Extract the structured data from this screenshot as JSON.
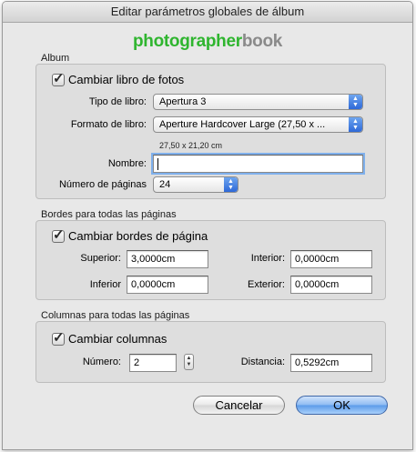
{
  "window": {
    "title": "Editar parámetros globales de álbum"
  },
  "logo": {
    "part1": "photographer",
    "part2": "book"
  },
  "album": {
    "section_label": "Album",
    "change_book": {
      "label": "Cambiar libro de fotos",
      "checked": true
    },
    "book_type": {
      "label": "Tipo de libro:",
      "value": "Apertura 3"
    },
    "book_format": {
      "label": "Formato de libro:",
      "value": "Aperture Hardcover Large (27,50 x ...",
      "dimensions": "27,50 x 21,20 cm"
    },
    "name": {
      "label": "Nombre:",
      "value": ""
    },
    "page_count": {
      "label": "Número de páginas",
      "value": "24"
    }
  },
  "borders": {
    "section_label": "Bordes para todas las páginas",
    "change_borders": {
      "label": "Cambiar bordes de página",
      "checked": true
    },
    "top": {
      "label": "Superior:",
      "value": "3,0000cm"
    },
    "inner": {
      "label": "Interior:",
      "value": "0,0000cm"
    },
    "bottom": {
      "label": "Inferior",
      "value": "0,0000cm"
    },
    "outer": {
      "label": "Exterior:",
      "value": "0,0000cm"
    }
  },
  "columns": {
    "section_label": "Columnas para todas las páginas",
    "change_columns": {
      "label": "Cambiar columnas",
      "checked": true
    },
    "number": {
      "label": "Número:",
      "value": "2"
    },
    "distance": {
      "label": "Distancia:",
      "value": "0,5292cm"
    }
  },
  "buttons": {
    "cancel": "Cancelar",
    "ok": "OK"
  },
  "colors": {
    "logo_green": "#2fb52f",
    "logo_gray": "#8a8a8a",
    "default_button": "#5a9ae9"
  },
  "icons": {
    "check": "checkmark-icon",
    "popup": "updown-arrows-icon",
    "stepper": "stepper-arrows-icon"
  }
}
